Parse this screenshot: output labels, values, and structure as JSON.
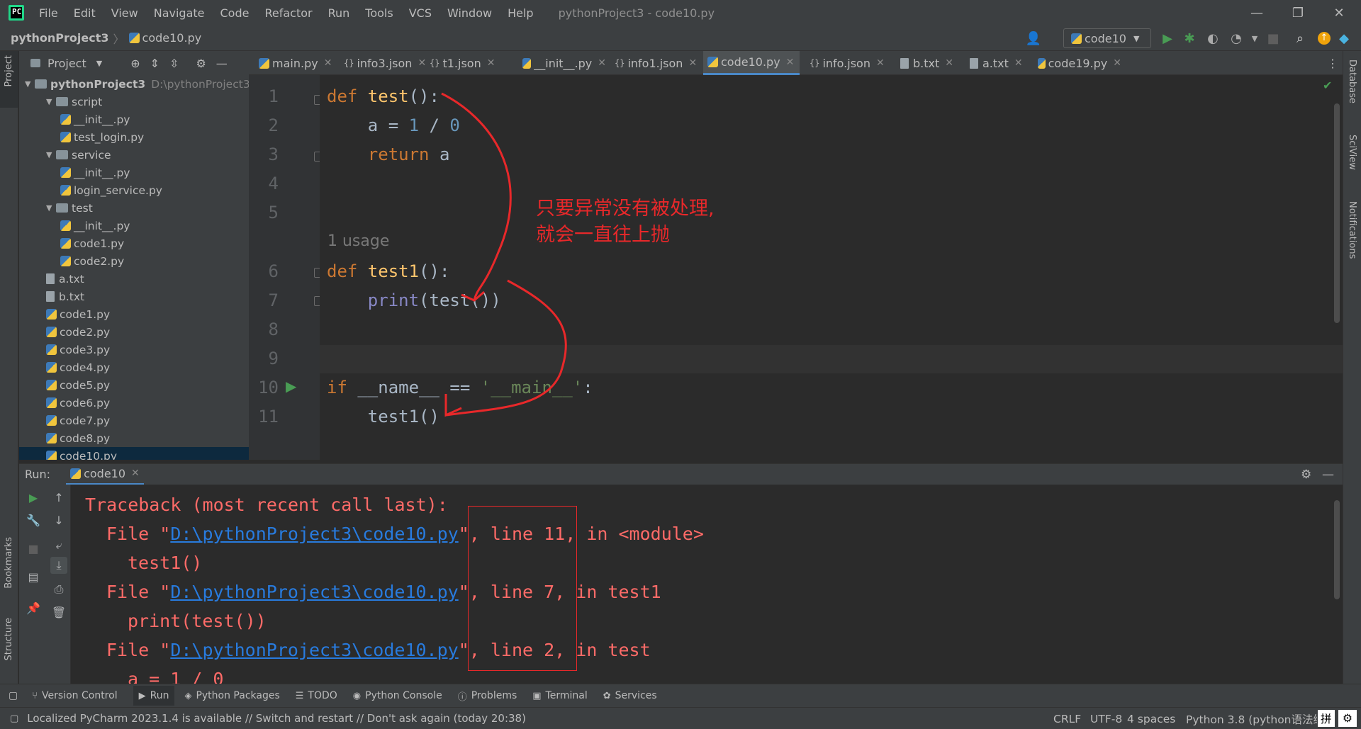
{
  "app": {
    "menu": [
      "File",
      "Edit",
      "View",
      "Navigate",
      "Code",
      "Refactor",
      "Run",
      "Tools",
      "VCS",
      "Window",
      "Help"
    ],
    "title": "pythonProject3 - code10.py"
  },
  "navbar": {
    "project": "pythonProject3",
    "file": "code10.py",
    "run_config": "code10"
  },
  "project_panel": {
    "title": "Project",
    "root": "pythonProject3",
    "root_path": "D:\\pythonProject3",
    "tree": [
      {
        "label": "script",
        "type": "folder"
      },
      {
        "label": "__init__.py",
        "type": "py"
      },
      {
        "label": "test_login.py",
        "type": "py"
      },
      {
        "label": "service",
        "type": "folder"
      },
      {
        "label": "__init__.py",
        "type": "py"
      },
      {
        "label": "login_service.py",
        "type": "py"
      },
      {
        "label": "test",
        "type": "folder"
      },
      {
        "label": "__init__.py",
        "type": "py"
      },
      {
        "label": "code1.py",
        "type": "py"
      },
      {
        "label": "code2.py",
        "type": "py"
      },
      {
        "label": "a.txt",
        "type": "txt"
      },
      {
        "label": "b.txt",
        "type": "txt"
      },
      {
        "label": "code1.py",
        "type": "py"
      },
      {
        "label": "code2.py",
        "type": "py"
      },
      {
        "label": "code3.py",
        "type": "py"
      },
      {
        "label": "code4.py",
        "type": "py"
      },
      {
        "label": "code5.py",
        "type": "py"
      },
      {
        "label": "code6.py",
        "type": "py"
      },
      {
        "label": "code7.py",
        "type": "py"
      },
      {
        "label": "code8.py",
        "type": "py"
      },
      {
        "label": "code10.py",
        "type": "py"
      }
    ]
  },
  "tabs": [
    {
      "label": "main.py",
      "icon": "py"
    },
    {
      "label": "info3.json",
      "icon": "json"
    },
    {
      "label": "t1.json",
      "icon": "json"
    },
    {
      "label": "__init__.py",
      "icon": "py"
    },
    {
      "label": "info1.json",
      "icon": "json"
    },
    {
      "label": "code10.py",
      "icon": "py",
      "active": true
    },
    {
      "label": "info.json",
      "icon": "json"
    },
    {
      "label": "b.txt",
      "icon": "txt"
    },
    {
      "label": "a.txt",
      "icon": "txt"
    },
    {
      "label": "code19.py",
      "icon": "py"
    }
  ],
  "editor": {
    "line_numbers": [
      "1",
      "2",
      "3",
      "4",
      "5",
      "6",
      "7",
      "8",
      "9",
      "10",
      "11"
    ],
    "usage_hint": "1 usage",
    "annotation": [
      "只要异常没有被处理,",
      "就会一直往上抛"
    ]
  },
  "run_panel": {
    "label": "Run:",
    "tab": "code10",
    "traceback_header": "Traceback (most recent call last):",
    "frames": [
      {
        "file": "D:\\pythonProject3\\code10.py",
        "location": ", line 11, in <module>",
        "source": "test1()"
      },
      {
        "file": "D:\\pythonProject3\\code10.py",
        "location": ", line 7, in test1",
        "source": "print(test())"
      },
      {
        "file": "D:\\pythonProject3\\code10.py",
        "location": ", line 2, in test",
        "source": "a = 1 / 0"
      }
    ]
  },
  "bottom_tools": [
    "Version Control",
    "Run",
    "Python Packages",
    "TODO",
    "Python Console",
    "Problems",
    "Terminal",
    "Services"
  ],
  "statusbar": {
    "message": "Localized PyCharm 2023.1.4 is available // Switch and restart // Don't ask again (today 20:38)",
    "line_sep": "CRLF",
    "encoding": "UTF-8",
    "indent": "4 spaces",
    "interpreter": "Python 3.8 (python语法练",
    "ime": "拼"
  },
  "side_labels": {
    "left": [
      "Project",
      "Bookmarks",
      "Structure"
    ],
    "right": [
      "Database",
      "SciView",
      "Notifications"
    ]
  },
  "colors": {
    "accent": "#4a88c7",
    "annotation_red": "#e8282a",
    "error_text": "#ff6b68",
    "link": "#287bde"
  }
}
